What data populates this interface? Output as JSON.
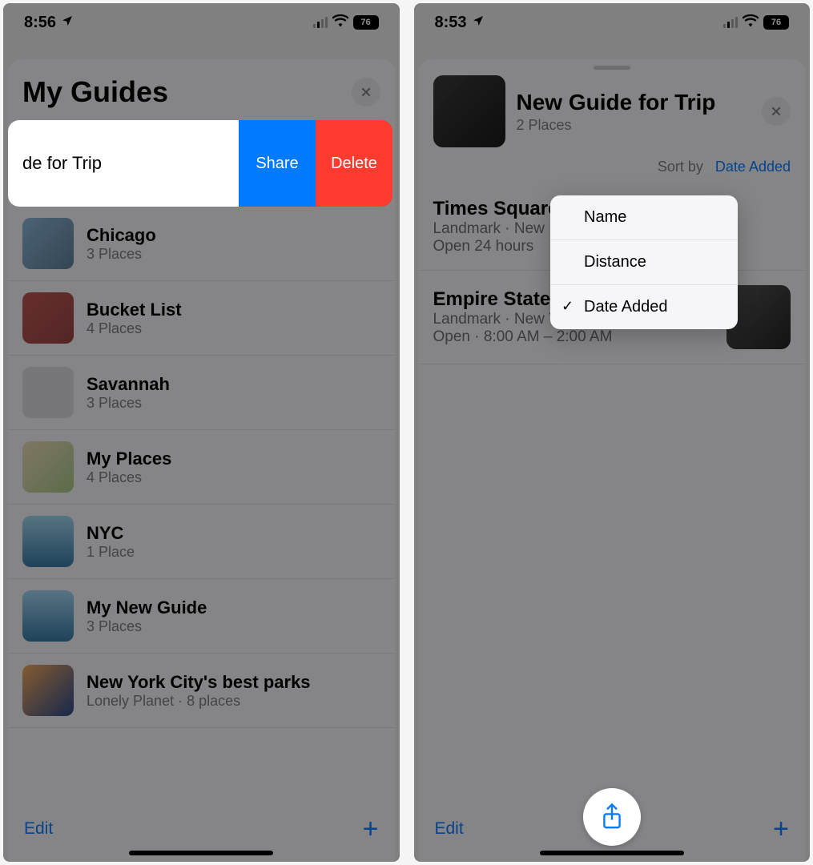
{
  "left": {
    "status": {
      "time": "8:56",
      "battery": "76"
    },
    "title": "My Guides",
    "swiped": {
      "visible_title_fragment": "de for Trip",
      "share": "Share",
      "delete": "Delete"
    },
    "guides": [
      {
        "name": "Chicago",
        "sub": "3 Places"
      },
      {
        "name": "Bucket List",
        "sub": "4 Places"
      },
      {
        "name": "Savannah",
        "sub": "3 Places"
      },
      {
        "name": "My Places",
        "sub": "4 Places"
      },
      {
        "name": "NYC",
        "sub": "1 Place"
      },
      {
        "name": "My New Guide",
        "sub": "3 Places"
      },
      {
        "name": "New York City's best parks",
        "sub": "Lonely Planet · 8 places"
      }
    ],
    "toolbar": {
      "edit": "Edit"
    }
  },
  "right": {
    "status": {
      "time": "8:53",
      "battery": "76"
    },
    "header": {
      "title": "New Guide for Trip",
      "sub": "2 Places"
    },
    "sort": {
      "label": "Sort by",
      "value": "Date Added"
    },
    "popup": {
      "items": [
        {
          "label": "Name",
          "checked": false
        },
        {
          "label": "Distance",
          "checked": false
        },
        {
          "label": "Date Added",
          "checked": true
        }
      ]
    },
    "places": [
      {
        "title": "Times Square",
        "sub1": "Landmark · New",
        "sub2": "Open 24 hours"
      },
      {
        "title": "Empire State",
        "sub1": "Landmark · New York",
        "sub2": "Open · 8:00 AM – 2:00 AM"
      }
    ],
    "toolbar": {
      "edit": "Edit"
    }
  }
}
